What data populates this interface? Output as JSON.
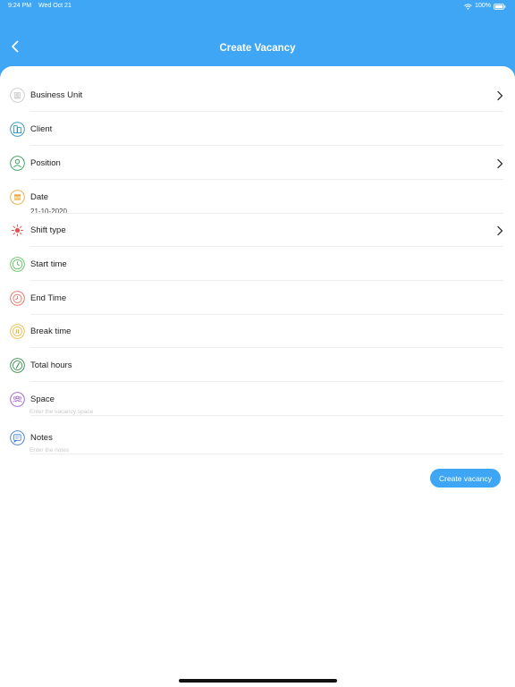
{
  "status_bar": {
    "time": "9:24 PM",
    "date": "Wed Oct 21",
    "battery": "100%"
  },
  "header": {
    "title": "Create Vacancy",
    "back_icon": "chevron-left-icon"
  },
  "form": {
    "business_unit": {
      "label": "Business Unit",
      "icon": "building-icon"
    },
    "client": {
      "label": "Client",
      "icon": "office-building-icon"
    },
    "position": {
      "label": "Position",
      "icon": "user-icon"
    },
    "date": {
      "label": "Date",
      "value": "21-10-2020",
      "icon": "calendar-icon"
    },
    "shift_type": {
      "label": "Shift type",
      "icon": "sun-icon"
    },
    "start_time": {
      "label": "Start time",
      "icon": "clock-icon"
    },
    "end_time": {
      "label": "End Time",
      "icon": "alarm-clock-icon"
    },
    "break_time": {
      "label": "Break time",
      "icon": "pause-icon"
    },
    "total_hours": {
      "label": "Total hours",
      "icon": "stopwatch-icon"
    },
    "space": {
      "label": "Space",
      "placeholder": "Enter the vacancy space",
      "icon": "people-icon"
    },
    "notes": {
      "label": "Notes",
      "placeholder": "Enter the notes",
      "icon": "note-icon"
    }
  },
  "actions": {
    "create_label": "Create vacancy"
  },
  "colors": {
    "accent": "#3fa6f5",
    "background": "#ffffff",
    "divider": "#eeeeee"
  }
}
